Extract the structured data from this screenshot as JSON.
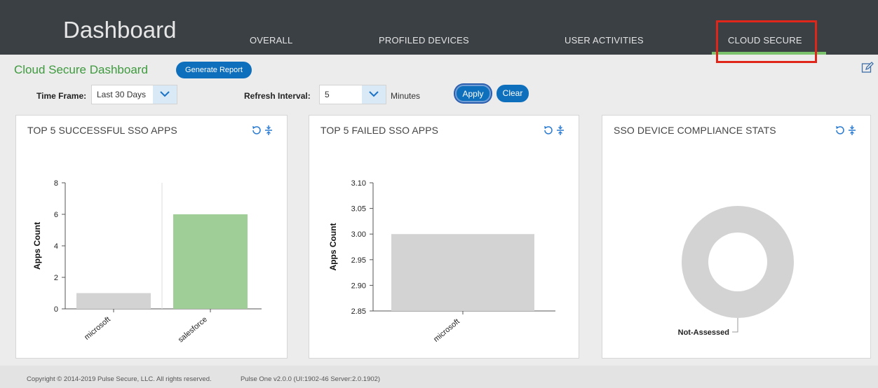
{
  "header": {
    "title": "Dashboard",
    "tabs": [
      {
        "label": "OVERALL",
        "active": false
      },
      {
        "label": "PROFILED DEVICES",
        "active": false
      },
      {
        "label": "USER ACTIVITIES",
        "active": false
      },
      {
        "label": "CLOUD SECURE",
        "active": true
      }
    ]
  },
  "toolbar": {
    "dashboard_title": "Cloud Secure Dashboard",
    "generate_report_label": "Generate Report",
    "time_frame_label": "Time Frame:",
    "time_frame_value": "Last 30 Days",
    "refresh_label": "Refresh Interval:",
    "refresh_value": "5",
    "minutes_label": "Minutes",
    "apply_label": "Apply",
    "clear_label": "Clear"
  },
  "panels": [
    {
      "title": "TOP 5 SUCCESSFUL SSO APPS"
    },
    {
      "title": "TOP 5 FAILED SSO APPS"
    },
    {
      "title": "SSO DEVICE COMPLIANCE STATS"
    }
  ],
  "chart_data": [
    {
      "type": "bar",
      "title": "TOP 5 SUCCESSFUL SSO APPS",
      "categories": [
        "microsoft",
        "salesforce"
      ],
      "values": [
        1,
        6
      ],
      "ylabel": "Apps Count",
      "ylim": [
        0,
        8
      ],
      "yticks": [
        "0",
        "2",
        "4",
        "6",
        "8"
      ],
      "colors": [
        "#d3d3d3",
        "#9fcf97"
      ]
    },
    {
      "type": "bar",
      "title": "TOP 5 FAILED SSO APPS",
      "categories": [
        "microsoft"
      ],
      "values": [
        3.0
      ],
      "ylabel": "Apps Count",
      "ylim": [
        2.85,
        3.1
      ],
      "yticks": [
        "2.85",
        "2.90",
        "2.95",
        "3.00",
        "3.05",
        "3.10"
      ],
      "colors": [
        "#d3d3d3"
      ]
    },
    {
      "type": "pie",
      "title": "SSO DEVICE COMPLIANCE STATS",
      "labels": [
        "Not-Assessed"
      ],
      "values": [
        100
      ],
      "colors": [
        "#d3d3d3"
      ]
    }
  ],
  "footer": {
    "copyright": "Copyright © 2014-2019 Pulse Secure, LLC. All rights reserved.",
    "version": "Pulse One v2.0.0 (UI:1902-46 Server:2.0.1902)"
  },
  "colors": {
    "header_bg": "#3b4045",
    "accent_green": "#3e9a3e",
    "button_blue": "#0e6fbd",
    "highlight_red": "#e0261b"
  },
  "icons": [
    "refresh-icon",
    "expand-icon",
    "edit-icon",
    "chevron-down-icon"
  ]
}
